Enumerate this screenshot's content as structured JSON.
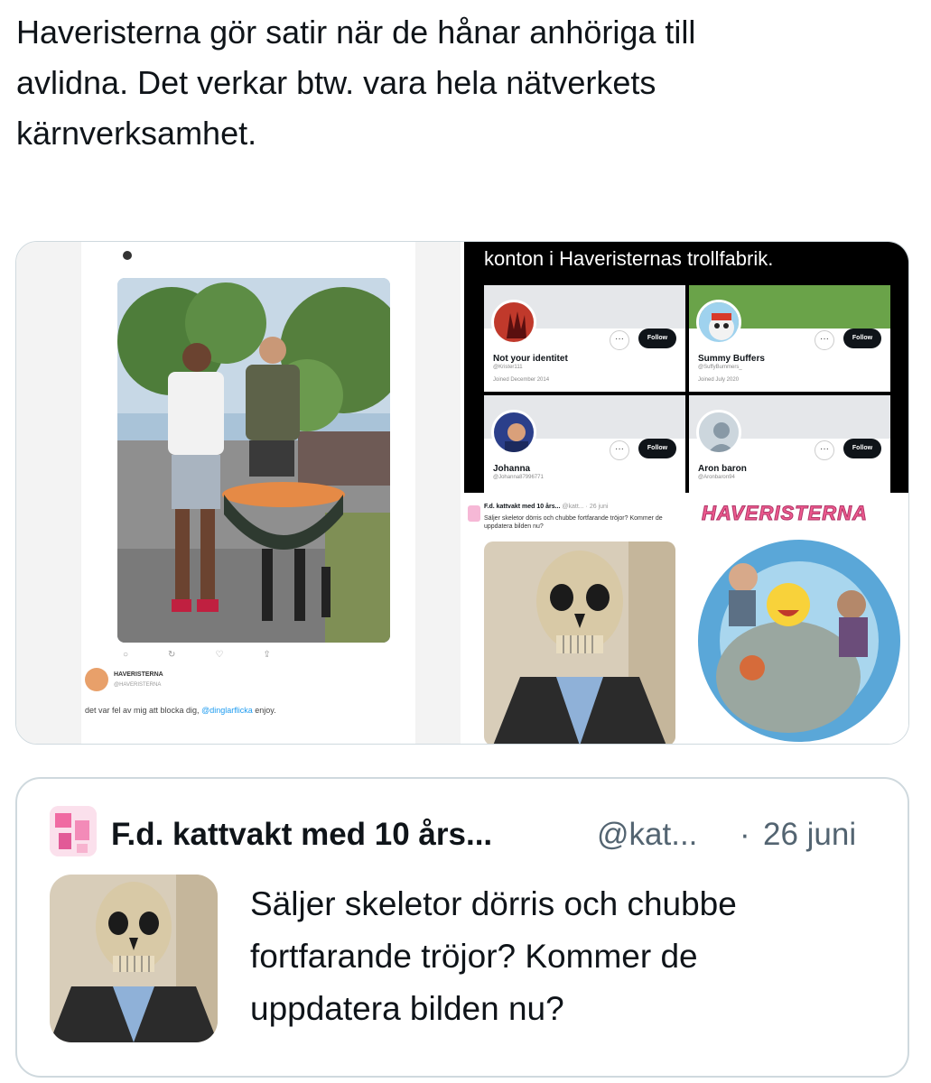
{
  "tweet": {
    "text": "Haveristerna gör satir när de hånar anhöriga till\navlidna. Det verkar btw. vara hela nätverkets\nkärnverksamhet."
  },
  "media": {
    "left": {
      "reply_text": "det var fel av mig att blocka dig,",
      "reply_mention": "@dinglarflicka",
      "reply_tail": "enjoy."
    },
    "top_right": {
      "title": "konton i Haveristernas trollfabrik.",
      "profiles": [
        {
          "name": "Not your identitet",
          "handle": "@Krister111",
          "joined": "Joined December 2014",
          "follow": "Follow",
          "dots": "···"
        },
        {
          "name": "Summy Buffers",
          "handle": "@SuffyBummers_",
          "joined": "Joined July 2020",
          "follow": "Follow",
          "dots": "···"
        },
        {
          "name": "Johanna",
          "handle": "@Johanna87996771",
          "joined": "",
          "follow": "Follow",
          "dots": "···"
        },
        {
          "name": "Aron baron",
          "handle": "@Aronbaron94",
          "joined": "",
          "follow": "Follow",
          "dots": "···"
        }
      ]
    },
    "bottom_left": {
      "name": "F.d. kattvakt med 10 års...",
      "meta": "@katt... · 26 juni",
      "text": "Säljer skeletor dörris och chubbe fortfarande tröjor? Kommer de uppdatera bilden nu?"
    },
    "bottom_right": {
      "title": "HAVERISTERNA"
    }
  },
  "quote": {
    "name": "F.d. kattvakt med 10 års...",
    "handle": "@kat...",
    "dot": "·",
    "date": "26 juni",
    "text": "Säljer skeletor dörris och chubbe\nfortfarande tröjor? Kommer de\nuppdatera bilden nu?"
  }
}
